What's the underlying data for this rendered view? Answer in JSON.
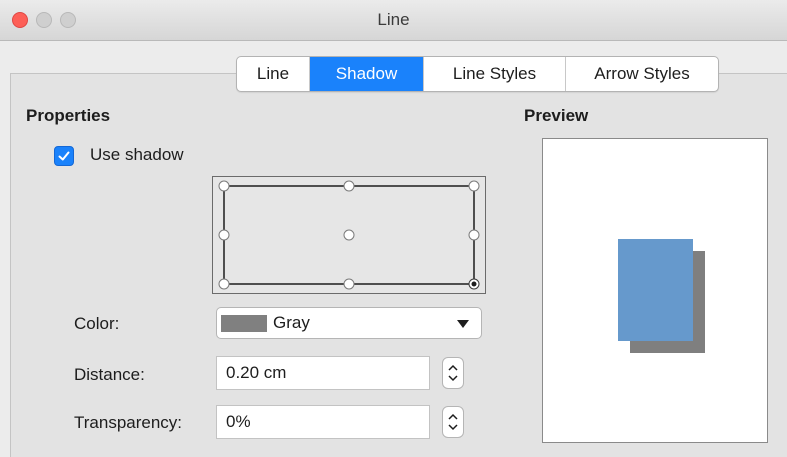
{
  "window": {
    "title": "Line"
  },
  "tabs": [
    {
      "label": "Line",
      "active": false
    },
    {
      "label": "Shadow",
      "active": true
    },
    {
      "label": "Line Styles",
      "active": false
    },
    {
      "label": "Arrow Styles",
      "active": false
    }
  ],
  "properties": {
    "title": "Properties",
    "use_shadow": {
      "label": "Use shadow",
      "checked": true
    },
    "position_grid": {
      "selected": "bottom-right"
    },
    "color": {
      "label": "Color:",
      "value": "Gray",
      "swatch": "#808080"
    },
    "distance": {
      "label": "Distance:",
      "value": "0.20 cm"
    },
    "transparency": {
      "label": "Transparency:",
      "value": "0%"
    }
  },
  "preview": {
    "title": "Preview",
    "object_color": "#6699cc",
    "shadow_color": "#7f7f7f"
  },
  "colors": {
    "accent": "#1a82fb",
    "close": "#fd5f57"
  }
}
